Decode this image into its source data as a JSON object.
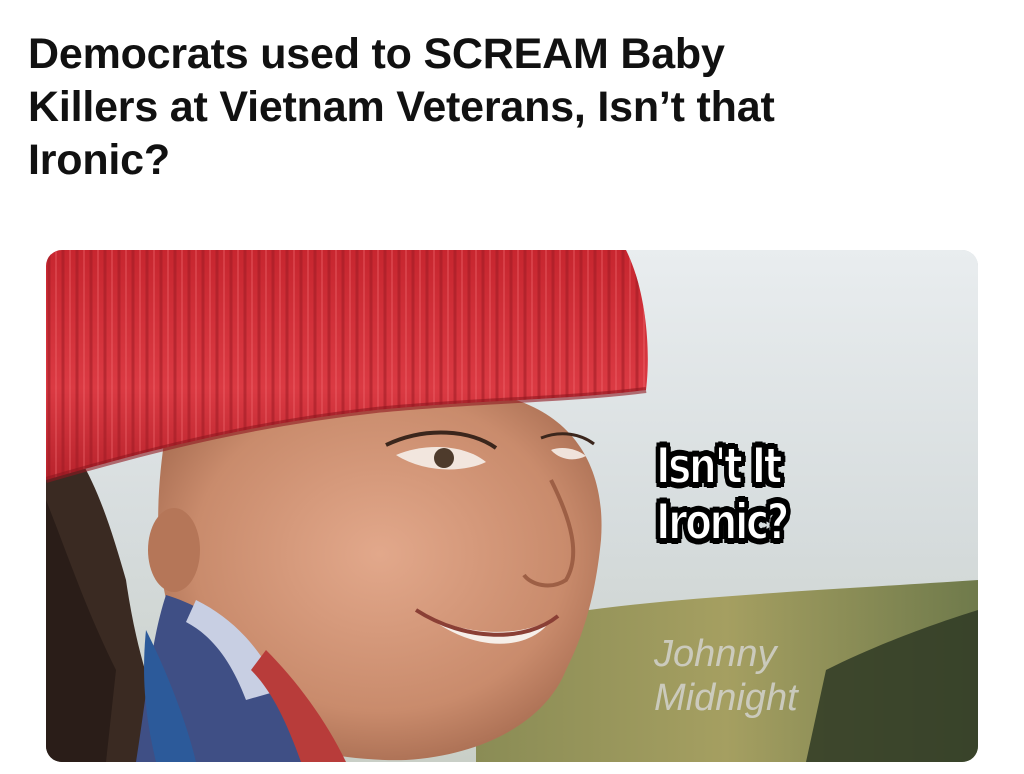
{
  "headline": {
    "line1": "Democrats used to SCREAM Baby",
    "line2": "Killers at Vietnam Veterans, Isn’t that",
    "line3": "Ironic?"
  },
  "meme": {
    "caption_line1": "Isn't It",
    "caption_line2": "Ironic?",
    "watermark_line1": "Johnny",
    "watermark_line2": "Midnight"
  },
  "colors": {
    "headline_text": "#111111",
    "hat_red": "#d8303a",
    "caption_fill": "#ffffff",
    "caption_outline": "#000000"
  }
}
